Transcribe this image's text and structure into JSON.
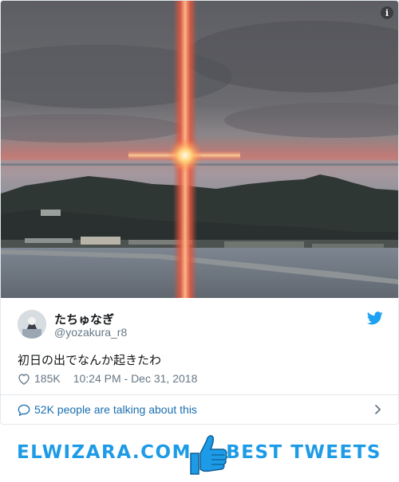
{
  "tweet": {
    "display_name": "たちゅなぎ",
    "handle": "@yozakura_r8",
    "text": "初日の出でなんか起きたわ",
    "likes": "185K",
    "timestamp": "10:24 PM - Dec 31, 2018",
    "talking": "52K people are talking about this"
  },
  "photo": {
    "description_icon": "info-icon",
    "info_glyph": "i"
  },
  "footer": {
    "brand": "ELWIZARA.COM",
    "tagline": "BEST TWEETS",
    "icon": "thumbs-up-icon"
  },
  "colors": {
    "accent": "#1d9be6",
    "link": "#1b6fb0",
    "muted": "#657786"
  }
}
